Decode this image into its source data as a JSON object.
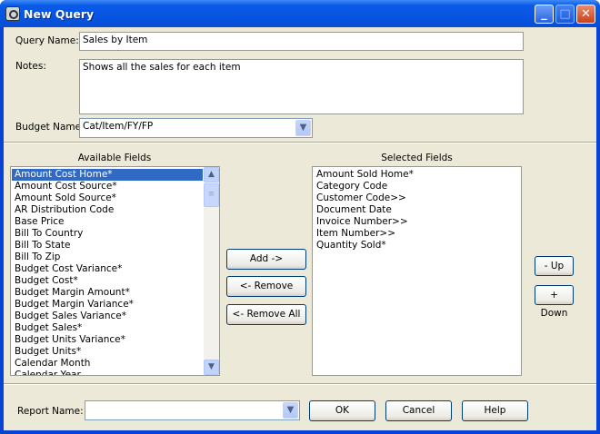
{
  "window": {
    "title": "New Query",
    "icon": "query-icon",
    "minimize": "_",
    "maximize": "□",
    "close": "✕"
  },
  "form": {
    "query_name_label": "Query Name:",
    "query_name_value": "Sales by Item",
    "notes_label": "Notes:",
    "notes_value": "Shows all the sales for each item",
    "budget_name_label": "Budget Name:",
    "budget_name_value": "Cat/Item/FY/FP"
  },
  "available": {
    "label": "Available Fields",
    "selected_index": 0,
    "items": [
      "Amount Cost Home*",
      "Amount Cost Source*",
      "Amount Sold Source*",
      "AR Distribution Code",
      "Base Price",
      "Bill To Country",
      "Bill To State",
      "Bill To Zip",
      "Budget Cost Variance*",
      "Budget Cost*",
      "Budget Margin Amount*",
      "Budget Margin Variance*",
      "Budget Sales Variance*",
      "Budget Sales*",
      "Budget Units Variance*",
      "Budget Units*",
      "Calendar Month",
      "Calendar Year"
    ]
  },
  "actions": {
    "add": "Add ->",
    "remove": "<- Remove",
    "remove_all": "<- Remove All"
  },
  "selected": {
    "label": "Selected Fields",
    "items": [
      "Amount Sold Home*",
      "Category Code",
      "Customer Code>>",
      "Document Date",
      "Invoice Number>>",
      "Item Number>>",
      "Quantity Sold*"
    ]
  },
  "order": {
    "up": "- Up",
    "down": "+ Down"
  },
  "footer": {
    "report_name_label": "Report Name:",
    "report_name_value": "",
    "ok": "OK",
    "cancel": "Cancel",
    "help": "Help"
  }
}
